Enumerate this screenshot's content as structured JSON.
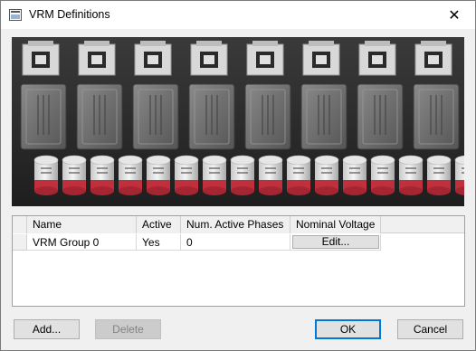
{
  "window": {
    "title": "VRM Definitions",
    "icon": "app-window-icon"
  },
  "close_icon_glyph": "✕",
  "image": {
    "description_name": "vrm-board-photo"
  },
  "table": {
    "columns": [
      "Name",
      "Active",
      "Num. Active Phases",
      "Nominal Voltage"
    ],
    "rows": [
      {
        "name": "VRM Group 0",
        "active": "Yes",
        "phases": "0",
        "voltage_button": "Edit..."
      }
    ]
  },
  "buttons": {
    "add": "Add...",
    "delete": "Delete",
    "ok": "OK",
    "cancel": "Cancel"
  }
}
